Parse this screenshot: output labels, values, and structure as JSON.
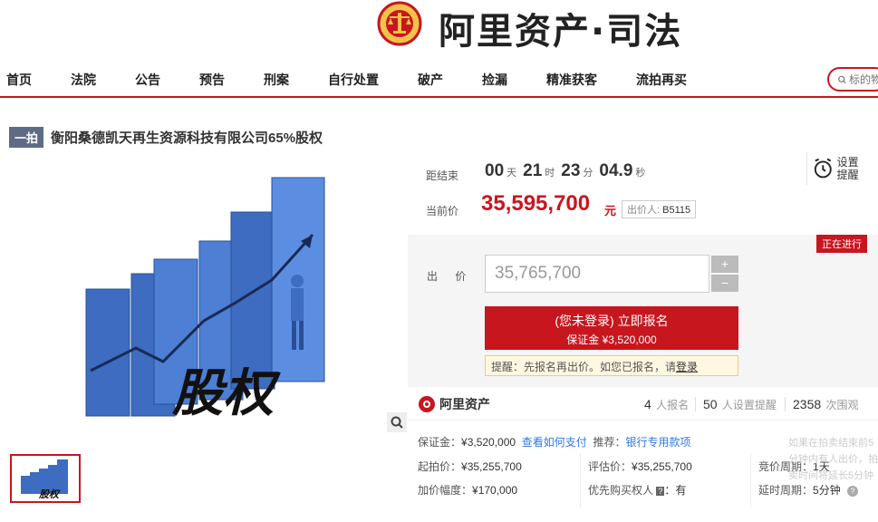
{
  "header": {
    "brand": "阿里资产·司法"
  },
  "nav": {
    "items": [
      "首页",
      "法院",
      "公告",
      "预告",
      "刑案",
      "自行处置",
      "破产",
      "捡漏",
      "精准获客",
      "流拍再买"
    ],
    "search_placeholder": "标的物"
  },
  "item": {
    "tag": "一拍",
    "title": "衡阳桑德凯天再生资源科技有限公司65%股权",
    "image_text": "股权"
  },
  "countdown": {
    "label": "距结束",
    "days": "00",
    "days_unit": "天",
    "hours": "21",
    "hours_unit": "时",
    "minutes": "23",
    "minutes_unit": "分",
    "seconds": "04.9",
    "seconds_unit": "秒"
  },
  "remind": {
    "label": "设置提醒"
  },
  "current_price": {
    "label": "当前价",
    "value": "35,595,700",
    "unit": "元",
    "bidder_label": "出价人:",
    "bidder": "B5115"
  },
  "bid": {
    "status": "正在进行",
    "label": "出 价",
    "value": "35,765,700",
    "plus": "+",
    "minus": "−",
    "signup_main": "(您未登录) 立即报名",
    "signup_sub": "保证金 ¥3,520,000",
    "tip_prefix": "提醒：先报名再出价。如您已报名，请",
    "tip_link": "登录"
  },
  "stats": {
    "logo": "阿里资产",
    "signups": "4",
    "signups_label": "人报名",
    "reminders": "50",
    "reminders_label": "人设置提醒",
    "views": "2358",
    "views_label": "次围观"
  },
  "details": {
    "deposit_label": "保证金：",
    "deposit": "¥3,520,000",
    "pay_link": "查看如何支付",
    "recommend_label": "推荐：",
    "recommend_link": "银行专用款项",
    "start_label": "起拍价：",
    "start": "¥35,255,700",
    "eval_label": "评估价：",
    "eval": "¥35,255,700",
    "period_label": "竞价周期：",
    "period": "1天",
    "increment_label": "加价幅度：",
    "increment": "¥170,000",
    "priority_label": "优先购买权人",
    "priority_badge": "?",
    "priority": "：有",
    "delay_label": "延时周期：",
    "delay": "5分钟"
  },
  "faded_text": "如果在拍卖结束前5分钟内有人出价，拍卖时间将延长5分钟",
  "colors": {
    "brand_red": "#c8161e",
    "nav_border": "#c8161e",
    "tag_bg": "#5f6b83",
    "bar_blue": "#3d6cc0"
  }
}
